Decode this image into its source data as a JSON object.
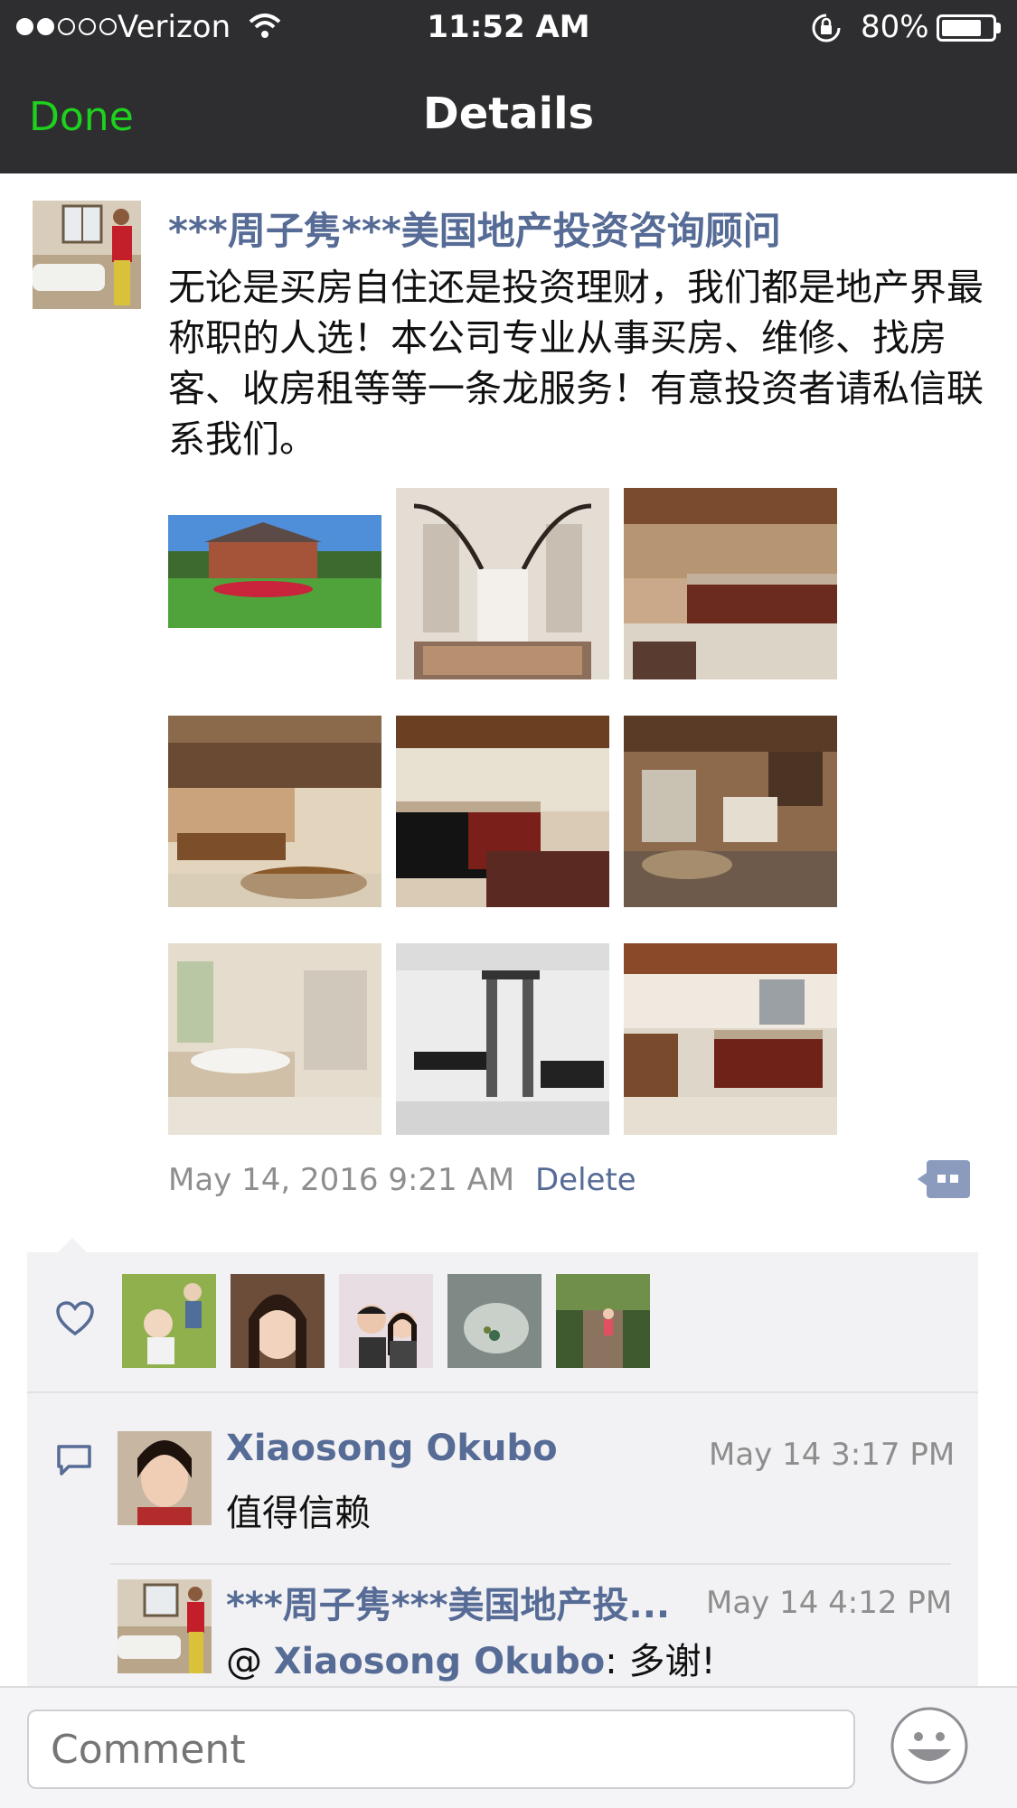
{
  "status": {
    "carrier": "Verizon",
    "time": "11:52 AM",
    "battery": "80%",
    "battery_level": 0.8
  },
  "nav": {
    "done_label": "Done",
    "title": "Details"
  },
  "post": {
    "author": "***周子隽***美国地产投资咨询顾问",
    "text": "无论是买房自住还是投资理财，我们都是地产界最称职的人选！本公司专业从事买房、维修、找房客、收房租等等一条龙服务！有意投资者请私信联系我们。",
    "date": "May 14, 2016 9:21 AM",
    "delete_label": "Delete"
  },
  "comments": [
    {
      "name": "Xiaosong Okubo",
      "time": "May 14 3:17 PM",
      "text": "值得信赖"
    },
    {
      "name": "***周子隽***美国地产投...",
      "time": "May 14 4:12 PM",
      "mention_prefix": "@ ",
      "mention": "Xiaosong Okubo",
      "text": ": 多谢!"
    }
  ],
  "comment_bar": {
    "placeholder": "Comment"
  },
  "colors": {
    "accent_green": "#1ed11e",
    "link_blue": "#566b95",
    "nav_bg": "#2e2e30",
    "panel_bg": "#f2f2f4"
  }
}
